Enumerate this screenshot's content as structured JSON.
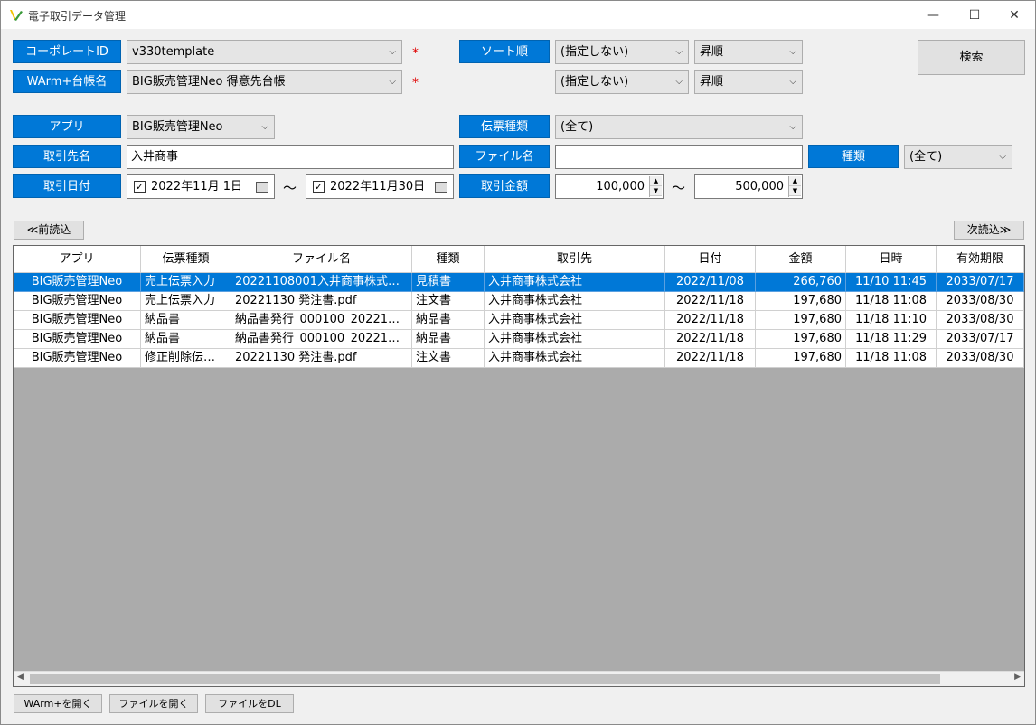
{
  "window": {
    "title": "電子取引データ管理",
    "minimize_glyph": "—",
    "maximize_glyph": "☐",
    "close_glyph": "✕"
  },
  "filters": {
    "corporate_id_label": "コーポレートID",
    "corporate_id_value": "v330template",
    "warm_ledger_label": "WArm+台帳名",
    "warm_ledger_value": "BIG販売管理Neo 得意先台帳",
    "required_mark": "*",
    "sort_label": "ソート順",
    "sort1_field": "(指定しない)",
    "sort1_order": "昇順",
    "sort2_field": "(指定しない)",
    "sort2_order": "昇順",
    "search_button": "検索",
    "app_label": "アプリ",
    "app_value": "BIG販売管理Neo",
    "slip_type_label": "伝票種類",
    "slip_type_value": "(全て)",
    "partner_label": "取引先名",
    "partner_value": "入井商事",
    "filename_label": "ファイル名",
    "filename_value": "",
    "kind_label": "種類",
    "kind_value": "(全て)",
    "date_label": "取引日付",
    "date_from": "2022年11月  1日",
    "date_to": "2022年11月30日",
    "amount_label": "取引金額",
    "amount_from": "100,000",
    "amount_to": "500,000",
    "tilde": "～",
    "check_mark": "✓"
  },
  "paging": {
    "prev_button": "≪前読込",
    "next_button": "次読込≫"
  },
  "table": {
    "columns": [
      "アプリ",
      "伝票種類",
      "ファイル名",
      "種類",
      "取引先",
      "日付",
      "金額",
      "日時",
      "有効期限"
    ],
    "rows": [
      [
        "BIG販売管理Neo",
        "売上伝票入力",
        "20221108001入井商事株式…",
        "見積書",
        "入井商事株式会社",
        "2022/11/08",
        "266,760",
        "11/10 11:45",
        "2033/07/17"
      ],
      [
        "BIG販売管理Neo",
        "売上伝票入力",
        "20221130 発注書.pdf",
        "注文書",
        "入井商事株式会社",
        "2022/11/18",
        "197,680",
        "11/18 11:08",
        "2033/08/30"
      ],
      [
        "BIG販売管理Neo",
        "納品書",
        "納品書発行_000100_20221…",
        "納品書",
        "入井商事株式会社",
        "2022/11/18",
        "197,680",
        "11/18 11:10",
        "2033/08/30"
      ],
      [
        "BIG販売管理Neo",
        "納品書",
        "納品書発行_000100_20221…",
        "納品書",
        "入井商事株式会社",
        "2022/11/18",
        "197,680",
        "11/18 11:29",
        "2033/07/17"
      ],
      [
        "BIG販売管理Neo",
        "修正削除伝…",
        "20221130 発注書.pdf",
        "注文書",
        "入井商事株式会社",
        "2022/11/18",
        "197,680",
        "11/18 11:08",
        "2033/08/30"
      ]
    ],
    "selected_row": 0
  },
  "footer": {
    "open_warm_button": "WArm+を開く",
    "open_file_button": "ファイルを開く",
    "download_button": "ファイルをDL"
  },
  "colors": {
    "accent": "#0078d7",
    "required": "#e00000",
    "grid_background": "#ababab"
  }
}
